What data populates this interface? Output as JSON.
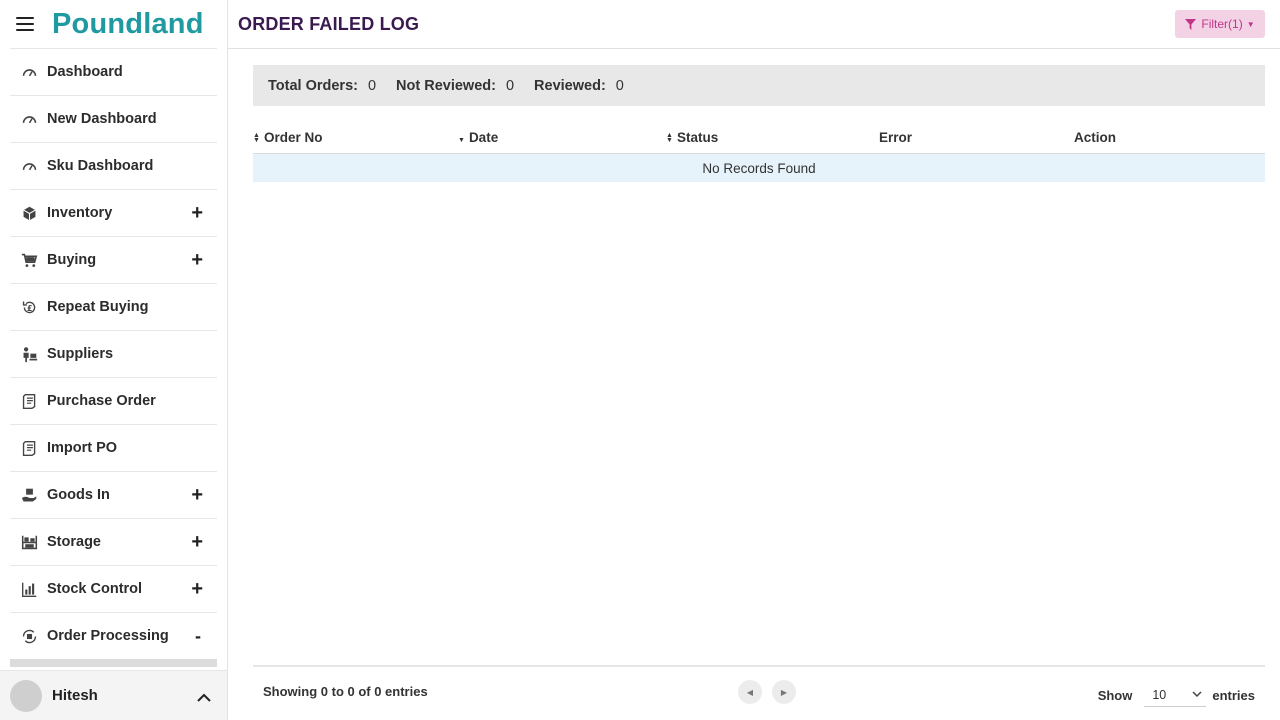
{
  "brand": {
    "name": "Poundland"
  },
  "sidebar": {
    "items": [
      {
        "label": "Dashboard",
        "icon": "gauge-icon",
        "toggle": ""
      },
      {
        "label": "New Dashboard",
        "icon": "gauge-icon",
        "toggle": ""
      },
      {
        "label": "Sku Dashboard",
        "icon": "gauge-icon",
        "toggle": ""
      },
      {
        "label": "Inventory",
        "icon": "box-icon",
        "toggle": "+"
      },
      {
        "label": "Buying",
        "icon": "cart-icon",
        "toggle": "+"
      },
      {
        "label": "Repeat Buying",
        "icon": "pound-refresh-icon",
        "toggle": ""
      },
      {
        "label": "Suppliers",
        "icon": "supplier-icon",
        "toggle": ""
      },
      {
        "label": "Purchase Order",
        "icon": "receipt-icon",
        "toggle": ""
      },
      {
        "label": "Import PO",
        "icon": "receipt-icon",
        "toggle": ""
      },
      {
        "label": "Goods In",
        "icon": "hand-box-icon",
        "toggle": "+"
      },
      {
        "label": "Storage",
        "icon": "shelves-icon",
        "toggle": "+"
      },
      {
        "label": "Stock Control",
        "icon": "bar-chart-icon",
        "toggle": "+"
      },
      {
        "label": "Order Processing",
        "icon": "order-cycle-icon",
        "toggle": "-"
      }
    ]
  },
  "user": {
    "name": "Hitesh"
  },
  "header": {
    "title": "ORDER FAILED LOG",
    "filter_label": "Filter(1)"
  },
  "summary": {
    "total_label": "Total Orders:",
    "total_value": "0",
    "not_reviewed_label": "Not Reviewed:",
    "not_reviewed_value": "0",
    "reviewed_label": "Reviewed:",
    "reviewed_value": "0"
  },
  "table": {
    "columns": [
      "Order No",
      "Date",
      "Status",
      "Error",
      "Action"
    ],
    "empty_text": "No Records Found"
  },
  "footer": {
    "showing_text": "Showing 0 to 0 of 0 entries",
    "show_label": "Show",
    "page_size": "10",
    "entries_label": "entries"
  },
  "colors": {
    "brand": "#1f9aa0",
    "title": "#3a1a4f",
    "filter_bg": "#f3d2e6",
    "filter_text": "#c2348a",
    "empty_row": "#e6f3fb"
  }
}
